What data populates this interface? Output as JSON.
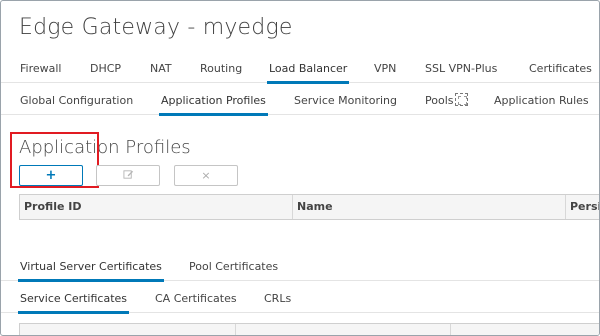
{
  "page": {
    "title": "Edge Gateway - myedge"
  },
  "main_tabs": [
    {
      "label": "Firewall"
    },
    {
      "label": "DHCP"
    },
    {
      "label": "NAT"
    },
    {
      "label": "Routing"
    },
    {
      "label": "Load Balancer",
      "active": true
    },
    {
      "label": "VPN"
    },
    {
      "label": "SSL VPN-Plus"
    },
    {
      "label": "Certificates"
    }
  ],
  "sub_tabs": [
    {
      "label": "Global Configuration"
    },
    {
      "label": "Application Profiles",
      "active": true
    },
    {
      "label": "Service Monitoring"
    },
    {
      "label": "Pools"
    },
    {
      "label": "Application Rules"
    }
  ],
  "section": {
    "title": "Application Profiles"
  },
  "toolbar": {
    "add_icon": "plus-icon",
    "add_label": "+",
    "edit_icon": "edit-icon",
    "delete_icon": "delete-x-icon",
    "delete_label": "×"
  },
  "grid": {
    "columns": [
      {
        "label": "Profile ID"
      },
      {
        "label": "Name"
      },
      {
        "label": "Persis"
      }
    ]
  },
  "cert_tabs": [
    {
      "label": "Virtual Server Certificates",
      "active": true
    },
    {
      "label": "Pool Certificates"
    }
  ],
  "cert_sub_tabs": [
    {
      "label": "Service Certificates",
      "active": true
    },
    {
      "label": "CA Certificates"
    },
    {
      "label": "CRLs"
    }
  ],
  "colors": {
    "accent": "#0079b8",
    "highlight_box": "#e11b22"
  }
}
